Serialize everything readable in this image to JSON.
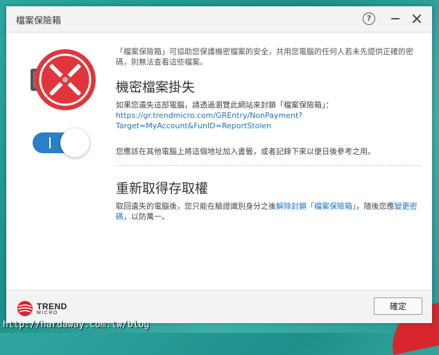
{
  "window": {
    "title": "檔案保險箱",
    "help_glyph": "?"
  },
  "description": "「檔案保險箱」可協助您保護機密檔案的安全，共用您電腦的任何人若未先提供正確的密碼，則無法查看這些檔案。",
  "lost": {
    "heading": "機密檔案掛失",
    "instruction": "如果您遺失這部電腦，請透過瀏覽此網站來封鎖「檔案保險箱」：",
    "url_line1": "https://gr.trendmicro.com/GREntry/NonPayment?",
    "url_line2": "Target=MyAccount&FunID=ReportStolen",
    "note": "您應該在其他電腦上將這個地址加入書籤，或者記錄下來以便日後參考之用。"
  },
  "regain": {
    "heading": "重新取得存取權",
    "text_before": "取回遺失的電腦後，您只能在驗證識別身分之後",
    "link1": "解除封鎖「檔案保險箱」",
    "text_middle": "，隨後您應",
    "link2": "變更密碼",
    "text_after": "，以防萬一。"
  },
  "footer": {
    "logo_main": "TREND",
    "logo_sub": "MICRO",
    "ok_label": "確定"
  },
  "watermark": "http://hardaway.com.tw/blog",
  "colors": {
    "accent_red": "#e2353b",
    "toggle_blue": "#2a7fc7",
    "link_blue": "#1f73c0"
  },
  "icons": [
    "vault-locked-icon",
    "help-icon",
    "minimize-icon",
    "close-icon",
    "trend-micro-logo"
  ]
}
